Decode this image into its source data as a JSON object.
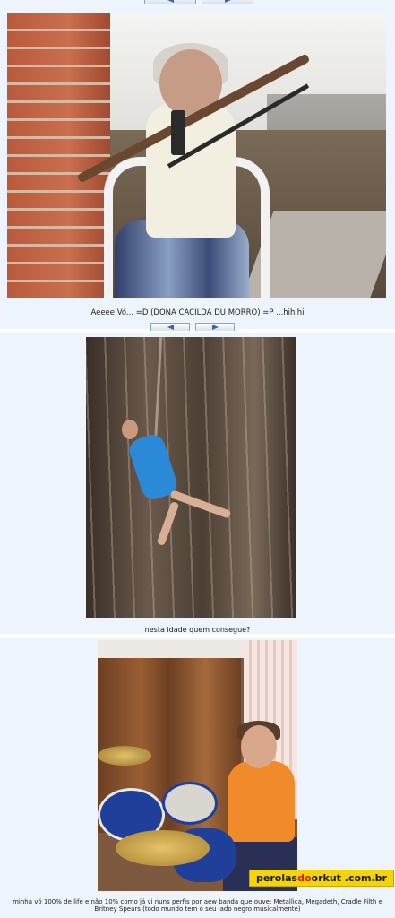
{
  "top_nav": {
    "prev_label": "",
    "next_label": ""
  },
  "posts": [
    {
      "caption": "Aeeee Vó... =D (DONA CACILDA DU MORRO) =P ...hihihi"
    },
    {
      "caption": "nesta idade quem consegue?"
    },
    {
      "caption": "minha vó 100% de life e não 10% como já vi nuns perfis por aew banda que ouve: Metallica, Megadeth, Cradle Filth e Britney Spears (todo mundo tem o seu lado negro musicalmente)"
    }
  ],
  "watermark": {
    "part1": "perolas",
    "part2": "do",
    "part3": "orkut",
    "part4": ".com.br"
  },
  "icons": {
    "prev": "arrow-left-icon",
    "next": "arrow-right-icon"
  },
  "colors": {
    "panel_bg": "#eef4fb",
    "button_arrow": "#3a66a6",
    "watermark_bg": "#f5d400",
    "watermark_accent": "#d02020"
  }
}
